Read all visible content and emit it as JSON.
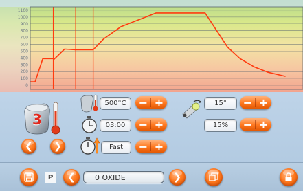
{
  "chart_data": {
    "type": "line",
    "title": "",
    "xlabel": "",
    "ylabel": "",
    "yticks": [
      "1100",
      "1000",
      "900",
      "800",
      "700",
      "600",
      "500",
      "400",
      "300",
      "200",
      "100",
      "0"
    ],
    "ylim": [
      0,
      1150
    ],
    "grid": true,
    "series": [
      {
        "values_x": [
          0,
          7,
          18,
          33,
          34,
          49,
          50,
          65,
          90,
          105,
          130,
          160,
          180,
          200,
          225,
          250,
          282,
          300,
          320,
          340,
          365
        ],
        "values_y": [
          50,
          50,
          390,
          390,
          380,
          530,
          530,
          520,
          520,
          680,
          860,
          980,
          1060,
          1060,
          1060,
          1060,
          560,
          390,
          270,
          190,
          130
        ]
      }
    ],
    "markers_x": [
      33,
      65,
      90
    ],
    "colors": {
      "line": "#ff3b10",
      "grid": "#5a6470"
    }
  },
  "settings": {
    "program_number": "3",
    "temperature": "500°C",
    "time": "03:00",
    "speed": "Fast",
    "angle": "15°",
    "percent": "15%"
  },
  "pill": {
    "minus": "−",
    "plus": "+"
  },
  "bottom": {
    "p_label": "P",
    "program_name": "0 OXIDE"
  },
  "icons": {
    "oven_thermometer": "oven-thermometer-icon",
    "crucible": "crucible-icon",
    "timer": "stopwatch-icon",
    "speed_timer": "stopwatch-speed-icon",
    "lamp": "tilt-lamp-icon",
    "left": "arrow-left-icon",
    "right": "arrow-right-icon",
    "save": "save-icon",
    "copy": "copy-icon",
    "lock": "lock-icon"
  },
  "accent": "#ff7a1f"
}
